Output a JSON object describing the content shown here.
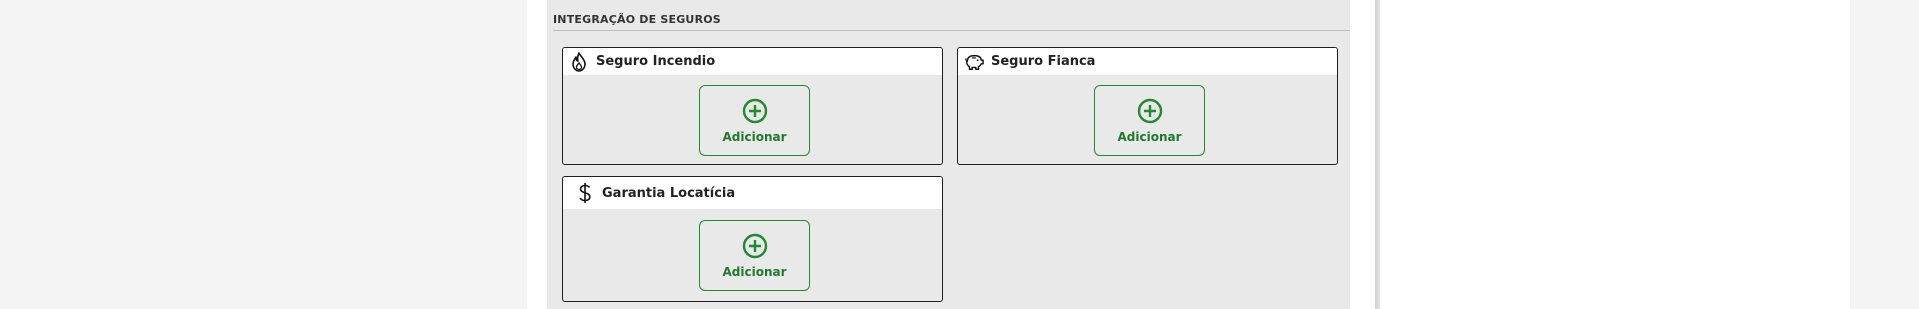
{
  "section": {
    "title": "INTEGRAÇÃO DE SEGUROS"
  },
  "cards": [
    {
      "title": "Seguro Incendio",
      "icon": "flame-icon",
      "button_label": "Adicionar"
    },
    {
      "title": "Seguro Fianca",
      "icon": "piggy-bank-icon",
      "button_label": "Adicionar"
    },
    {
      "title": "Garantia Locatícia",
      "icon": "dollar-icon",
      "button_label": "Adicionar"
    }
  ],
  "colors": {
    "accent": "#1f8a2e",
    "card_border": "#1f1f1f",
    "section_bg": "#e9e9e9"
  }
}
